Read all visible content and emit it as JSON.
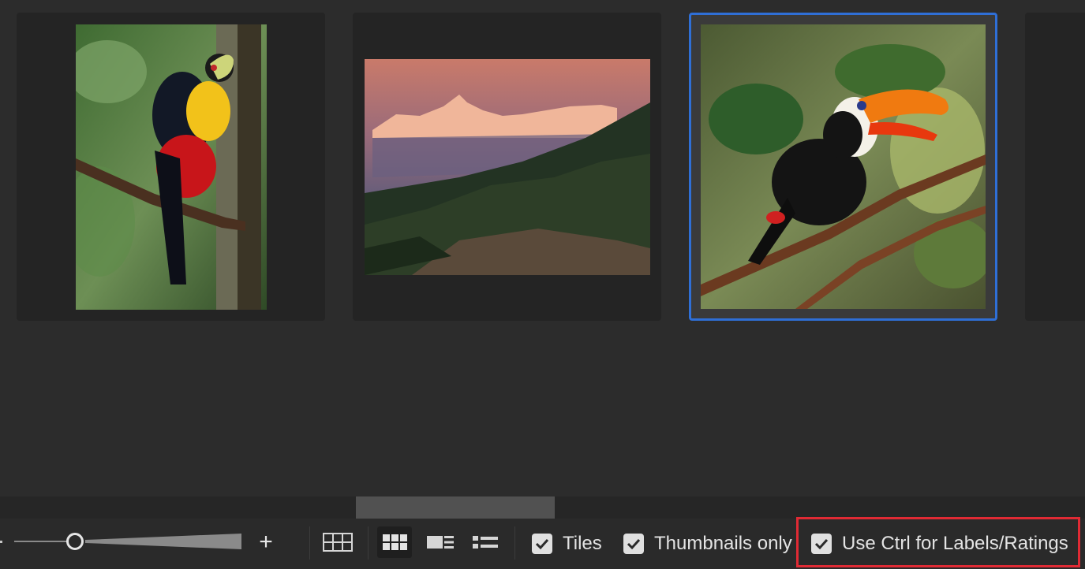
{
  "thumbnails": [
    {
      "name": "red-breasted-toucan",
      "selected": false
    },
    {
      "name": "himalayan-sunset-mountains",
      "selected": false
    },
    {
      "name": "toco-toucan",
      "selected": true
    }
  ],
  "footer": {
    "zoom_plus_label": "+",
    "view_modes": {
      "grid_outline": "grid-outline-icon",
      "grid_filled": "grid-filled-icon",
      "details": "details-view-icon",
      "list": "list-view-icon",
      "active": "grid_filled"
    },
    "tiles": {
      "label": "Tiles",
      "checked": true
    },
    "thumbnails_only": {
      "label": "Thumbnails only",
      "checked": true
    },
    "ctrl_labels": {
      "label": "Use Ctrl for Labels/Ratings",
      "checked": true
    }
  },
  "colors": {
    "selection": "#2f6fd6",
    "highlight": "#e02a34",
    "background": "#2c2c2c"
  }
}
